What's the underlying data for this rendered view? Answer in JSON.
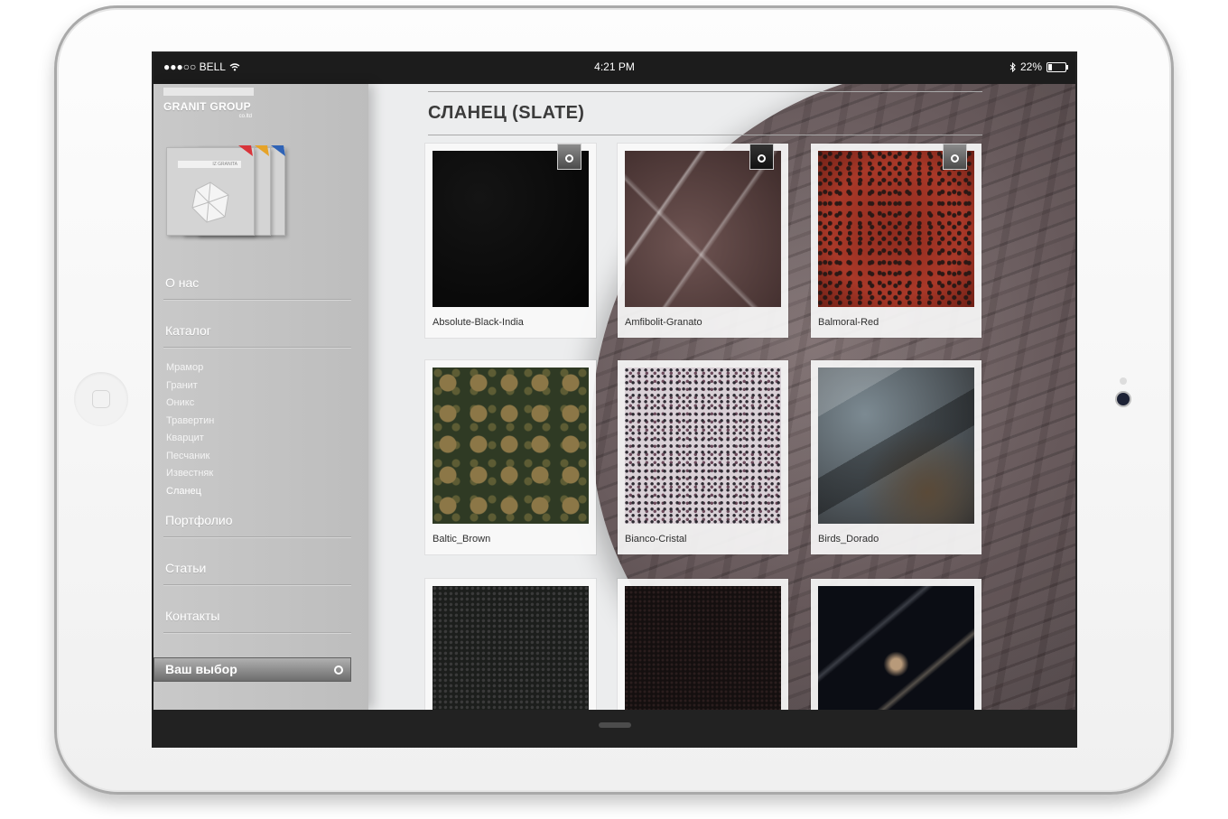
{
  "statusbar": {
    "carrier": "●●●○○ BELL",
    "time": "4:21 PM",
    "battery": "22%",
    "battery_level": 0.22
  },
  "logo": {
    "name": "GRANIT GROUP",
    "sub": "co.ltd"
  },
  "catalog_card": {
    "header": "IZ GRANITA"
  },
  "sidebar": {
    "items": [
      {
        "label": "О нас"
      },
      {
        "label": "Каталог"
      },
      {
        "label": "Портфолио"
      },
      {
        "label": "Статьи"
      },
      {
        "label": "Контакты"
      }
    ],
    "submenu": [
      {
        "label": "Мрамор"
      },
      {
        "label": "Гранит"
      },
      {
        "label": "Оникс"
      },
      {
        "label": "Травертин"
      },
      {
        "label": "Кварцит"
      },
      {
        "label": "Песчаник"
      },
      {
        "label": "Известняк"
      },
      {
        "label": "Сланец",
        "active": true
      }
    ],
    "choice_label": "Ваш выбор"
  },
  "main": {
    "title": "СЛАНЕЦ (SLATE)",
    "cards": [
      {
        "label": "Absolute-Black-India",
        "pin": "grey"
      },
      {
        "label": "Amfibolit-Granato",
        "pin": "dark"
      },
      {
        "label": "Balmoral-Red",
        "pin": "grey"
      },
      {
        "label": "Baltic_Brown"
      },
      {
        "label": "Bianco-Cristal"
      },
      {
        "label": "Birds_Dorado"
      },
      {
        "label": ""
      },
      {
        "label": ""
      },
      {
        "label": ""
      }
    ]
  },
  "colors": {
    "sidebar": "#c4c4c4",
    "statusbar": "#1c1c1c",
    "title": "#3b3b3b"
  }
}
